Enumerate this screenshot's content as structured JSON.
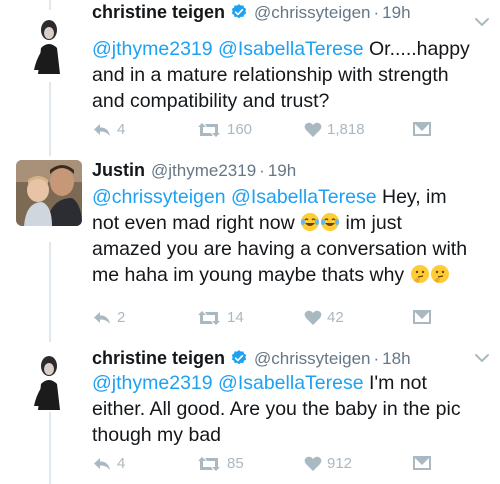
{
  "tweets": [
    {
      "name": "christine teigen",
      "handle": "@chrissyteigen",
      "dot": "·",
      "time": "19h",
      "verified": true,
      "mention1": "@jthyme2319",
      "mention2": "@IsabellaTerese",
      "line1_tail": " Or.....happy",
      "line2": "and in a mature relationship with strength",
      "line3": "and compatibility and trust?",
      "replies": "4",
      "retweets": "160",
      "likes": "1,818"
    },
    {
      "name": "Justin",
      "handle": "@jthyme2319",
      "dot": "·",
      "time": "19h",
      "verified": false,
      "mention1": "@chrissyteigen",
      "mention2": "@IsabellaTerese",
      "line1_tail": " Hey, im",
      "line2_head": "not even mad right now ",
      "line2_tail": " im just",
      "line3": "amazed you are having a conversation with",
      "line4": "me haha im young maybe thats why ",
      "replies": "2",
      "retweets": "14",
      "likes": "42"
    },
    {
      "name": "christine teigen",
      "handle": "@chrissyteigen",
      "dot": "·",
      "time": "18h",
      "verified": true,
      "mention1": "@jthyme2319",
      "mention2": "@IsabellaTerese",
      "line1_tail": " I'm not",
      "line2": "either. All good. Are you the baby in the pic",
      "line3": "though my bad",
      "replies": "4",
      "retweets": "85",
      "likes": "912"
    }
  ],
  "colors": {
    "link": "#1da1f2",
    "muted": "#657786",
    "icon": "#aab8c2",
    "thread": "#e1e8ed"
  },
  "icons": [
    "reply-icon",
    "retweet-icon",
    "like-icon",
    "direct-message-icon",
    "verified-badge-icon",
    "caret-down-icon",
    "laughing-crying-emoji",
    "thinking-face-emoji"
  ]
}
